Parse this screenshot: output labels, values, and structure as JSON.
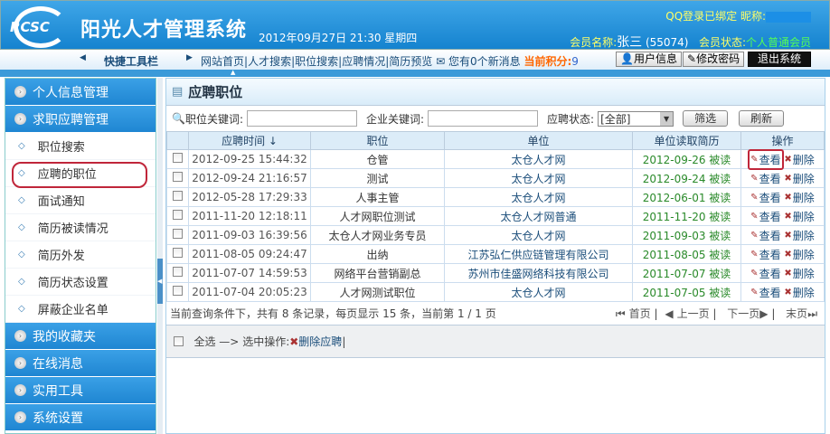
{
  "header": {
    "logo": "RCSC",
    "title": "阳光人才管理系统",
    "datetime": "2012年09月27日 21:30 星期四",
    "qq_status": "QQ登录已绑定 昵称:",
    "member_label": "会员名称:",
    "member_name": "张三",
    "member_id": "(55074)",
    "status_label": "会员状态:",
    "status_value": "个人普通会员"
  },
  "toolbar": {
    "title": "快捷工具栏",
    "links": [
      "网站首页",
      "人才搜索",
      "职位搜索",
      "应聘情况",
      "简历预览"
    ],
    "messages": "您有0个新消息",
    "score_label": "当前积分:",
    "score": "9",
    "user_info": "用户信息",
    "change_password": "修改密码",
    "logout": "退出系统"
  },
  "sidebar": {
    "groups": [
      "个人信息管理",
      "求职应聘管理"
    ],
    "items": [
      "职位搜索",
      "应聘的职位",
      "面试通知",
      "简历被读情况",
      "简历外发",
      "简历状态设置",
      "屏蔽企业名单"
    ],
    "groups_after": [
      "我的收藏夹",
      "在线消息",
      "实用工具",
      "系统设置"
    ]
  },
  "main": {
    "title": "应聘职位",
    "filter": {
      "job_keyword": "职位关键词:",
      "company_keyword": "企业关键词:",
      "status_label": "应聘状态:",
      "status_value": "[全部]",
      "filter_btn": "筛选",
      "refresh_btn": "刷新"
    },
    "columns": [
      "应聘时间 ↓",
      "职位",
      "单位",
      "单位读取简历",
      "操作"
    ],
    "rows": [
      {
        "time": "2012-09-25 15:44:32",
        "position": "仓管",
        "company": "太仓人才网",
        "read": "2012-09-26 被读"
      },
      {
        "time": "2012-09-24 21:16:57",
        "position": "测试",
        "company": "太仓人才网",
        "read": "2012-09-24 被读"
      },
      {
        "time": "2012-05-28 17:29:33",
        "position": "人事主管",
        "company": "太仓人才网",
        "read": "2012-06-01 被读"
      },
      {
        "time": "2011-11-20 12:18:11",
        "position": "人才网职位测试",
        "company": "太仓人才网普通",
        "read": "2011-11-20 被读"
      },
      {
        "time": "2011-09-03 16:39:56",
        "position": "太仓人才网业务专员",
        "company": "太仓人才网",
        "read": "2011-09-03 被读"
      },
      {
        "time": "2011-08-05 09:24:47",
        "position": "出纳",
        "company": "江苏弘仁供应链管理有限公司",
        "read": "2011-08-05 被读"
      },
      {
        "time": "2011-07-07 14:59:53",
        "position": "网络平台营销副总",
        "company": "苏州市佳盛网络科技有限公司",
        "read": "2011-07-07 被读"
      },
      {
        "time": "2011-07-04 20:05:23",
        "position": "人才网测试职位",
        "company": "太仓人才网",
        "read": "2011-07-05 被读"
      }
    ],
    "view": "查看",
    "delete": "删除",
    "summary": "当前查询条件下，共有 8 条记录，每页显示 15 条，当前第 1 / 1 页",
    "pager": [
      "首页",
      "上一页",
      "下一页",
      "末页"
    ],
    "select_all": "全选",
    "arrow": "—>",
    "selected_op": "选中操作:",
    "delete_apply": "删除应聘"
  }
}
